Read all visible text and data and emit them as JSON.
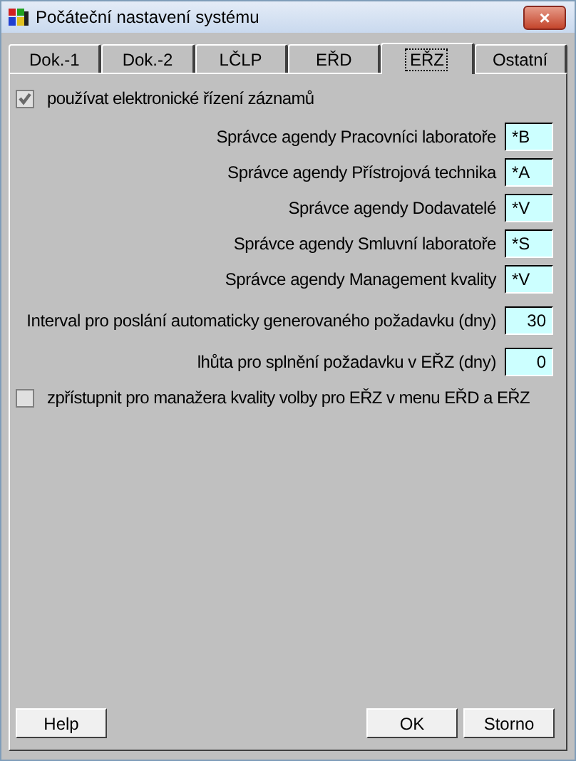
{
  "window": {
    "title": "Počáteční nastavení systému",
    "close": "×"
  },
  "tabs": [
    {
      "label": "Dok.-1",
      "selected": false
    },
    {
      "label": "Dok.-2",
      "selected": false
    },
    {
      "label": "LČLP",
      "selected": false
    },
    {
      "label": "EŘD",
      "selected": false
    },
    {
      "label": "EŘZ",
      "selected": true
    },
    {
      "label": "Ostatní",
      "selected": false
    }
  ],
  "use_checkbox": {
    "label": "používat elektronické řízení záznamů",
    "checked": true,
    "disabled": true
  },
  "fields": [
    {
      "label": "Správce agendy Pracovníci laboratoře",
      "value": "*B",
      "kind": "code"
    },
    {
      "label": "Správce agendy Přístrojová technika",
      "value": "*A",
      "kind": "code"
    },
    {
      "label": "Správce agendy Dodavatelé",
      "value": "*V",
      "kind": "code"
    },
    {
      "label": "Správce agendy Smluvní laboratoře",
      "value": "*S",
      "kind": "code"
    },
    {
      "label": "Správce agendy Management kvality",
      "value": "*V",
      "kind": "code"
    },
    {
      "label": "Interval pro poslání automaticky generovaného požadavku (dny)",
      "value": "30",
      "kind": "number"
    },
    {
      "label": "lhůta pro splnění požadavku v EŘZ (dny)",
      "value": "0",
      "kind": "number"
    }
  ],
  "manager_checkbox": {
    "label": "zpřístupnit pro manažera kvality volby pro EŘZ v menu  EŘD a EŘZ",
    "checked": false,
    "disabled": true
  },
  "buttons_left": [
    "Help"
  ],
  "buttons_right": [
    "OK",
    "Storno"
  ]
}
